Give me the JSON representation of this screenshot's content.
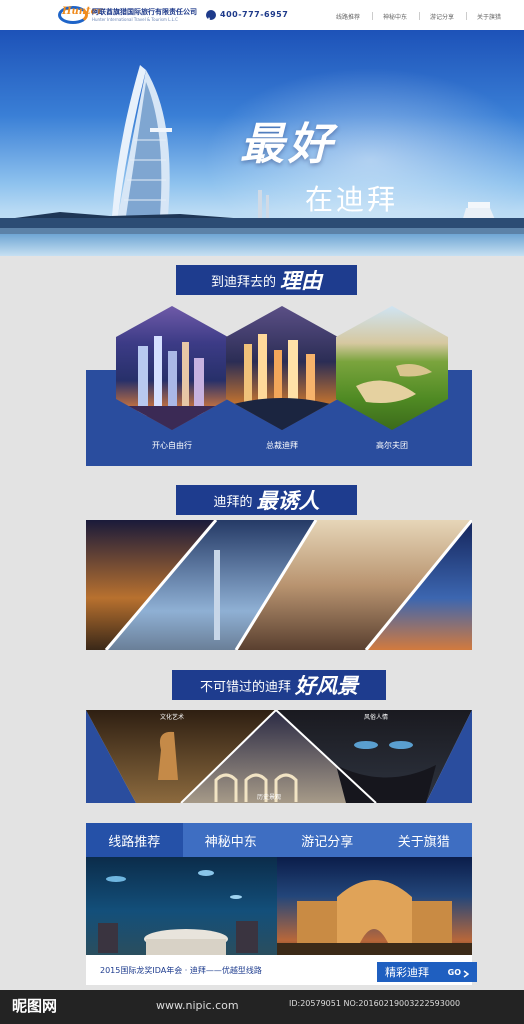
{
  "header": {
    "logo_mark": "Hunter",
    "company_cn": "阿联酋旗猎国际旅行有限责任公司",
    "company_en": "Hunter International Travel & Tourism L.L.C",
    "phone": "400-777-6957",
    "nav": [
      "线路推荐",
      "神秘中东",
      "游记分享",
      "关于旗猎"
    ]
  },
  "hero": {
    "line1": "最好",
    "line2": "在迪拜"
  },
  "section1": {
    "banner_prefix": "到迪拜去的",
    "banner_emphasis": "理由",
    "items": [
      "开心自由行",
      "总裁迪拜",
      "高尔夫团"
    ]
  },
  "section2": {
    "banner_prefix": "迪拜的",
    "banner_emphasis": "最诱人"
  },
  "section3": {
    "banner_prefix": "不可错过的迪拜",
    "banner_emphasis": "好风景",
    "labels": [
      "文化艺术",
      "风俗人情",
      "历史景观"
    ]
  },
  "tabs": [
    "线路推荐",
    "神秘中东",
    "游记分享",
    "关于旗猎"
  ],
  "news": {
    "text": "2015国际龙奖IDA年会 · 迪拜——优越型线路",
    "button_main": "精彩迪拜",
    "button_go": "GO"
  },
  "watermark": {
    "logo": "昵图网",
    "url": "www.nipic.com",
    "id": "ID:20579051 NO:20160219003222593000"
  },
  "colors": {
    "brand_dark": "#1e3c8e",
    "brand_tab": "#3e6ec2",
    "accent_orange": "#f08c1e",
    "page_bg": "#e3e3e3"
  }
}
